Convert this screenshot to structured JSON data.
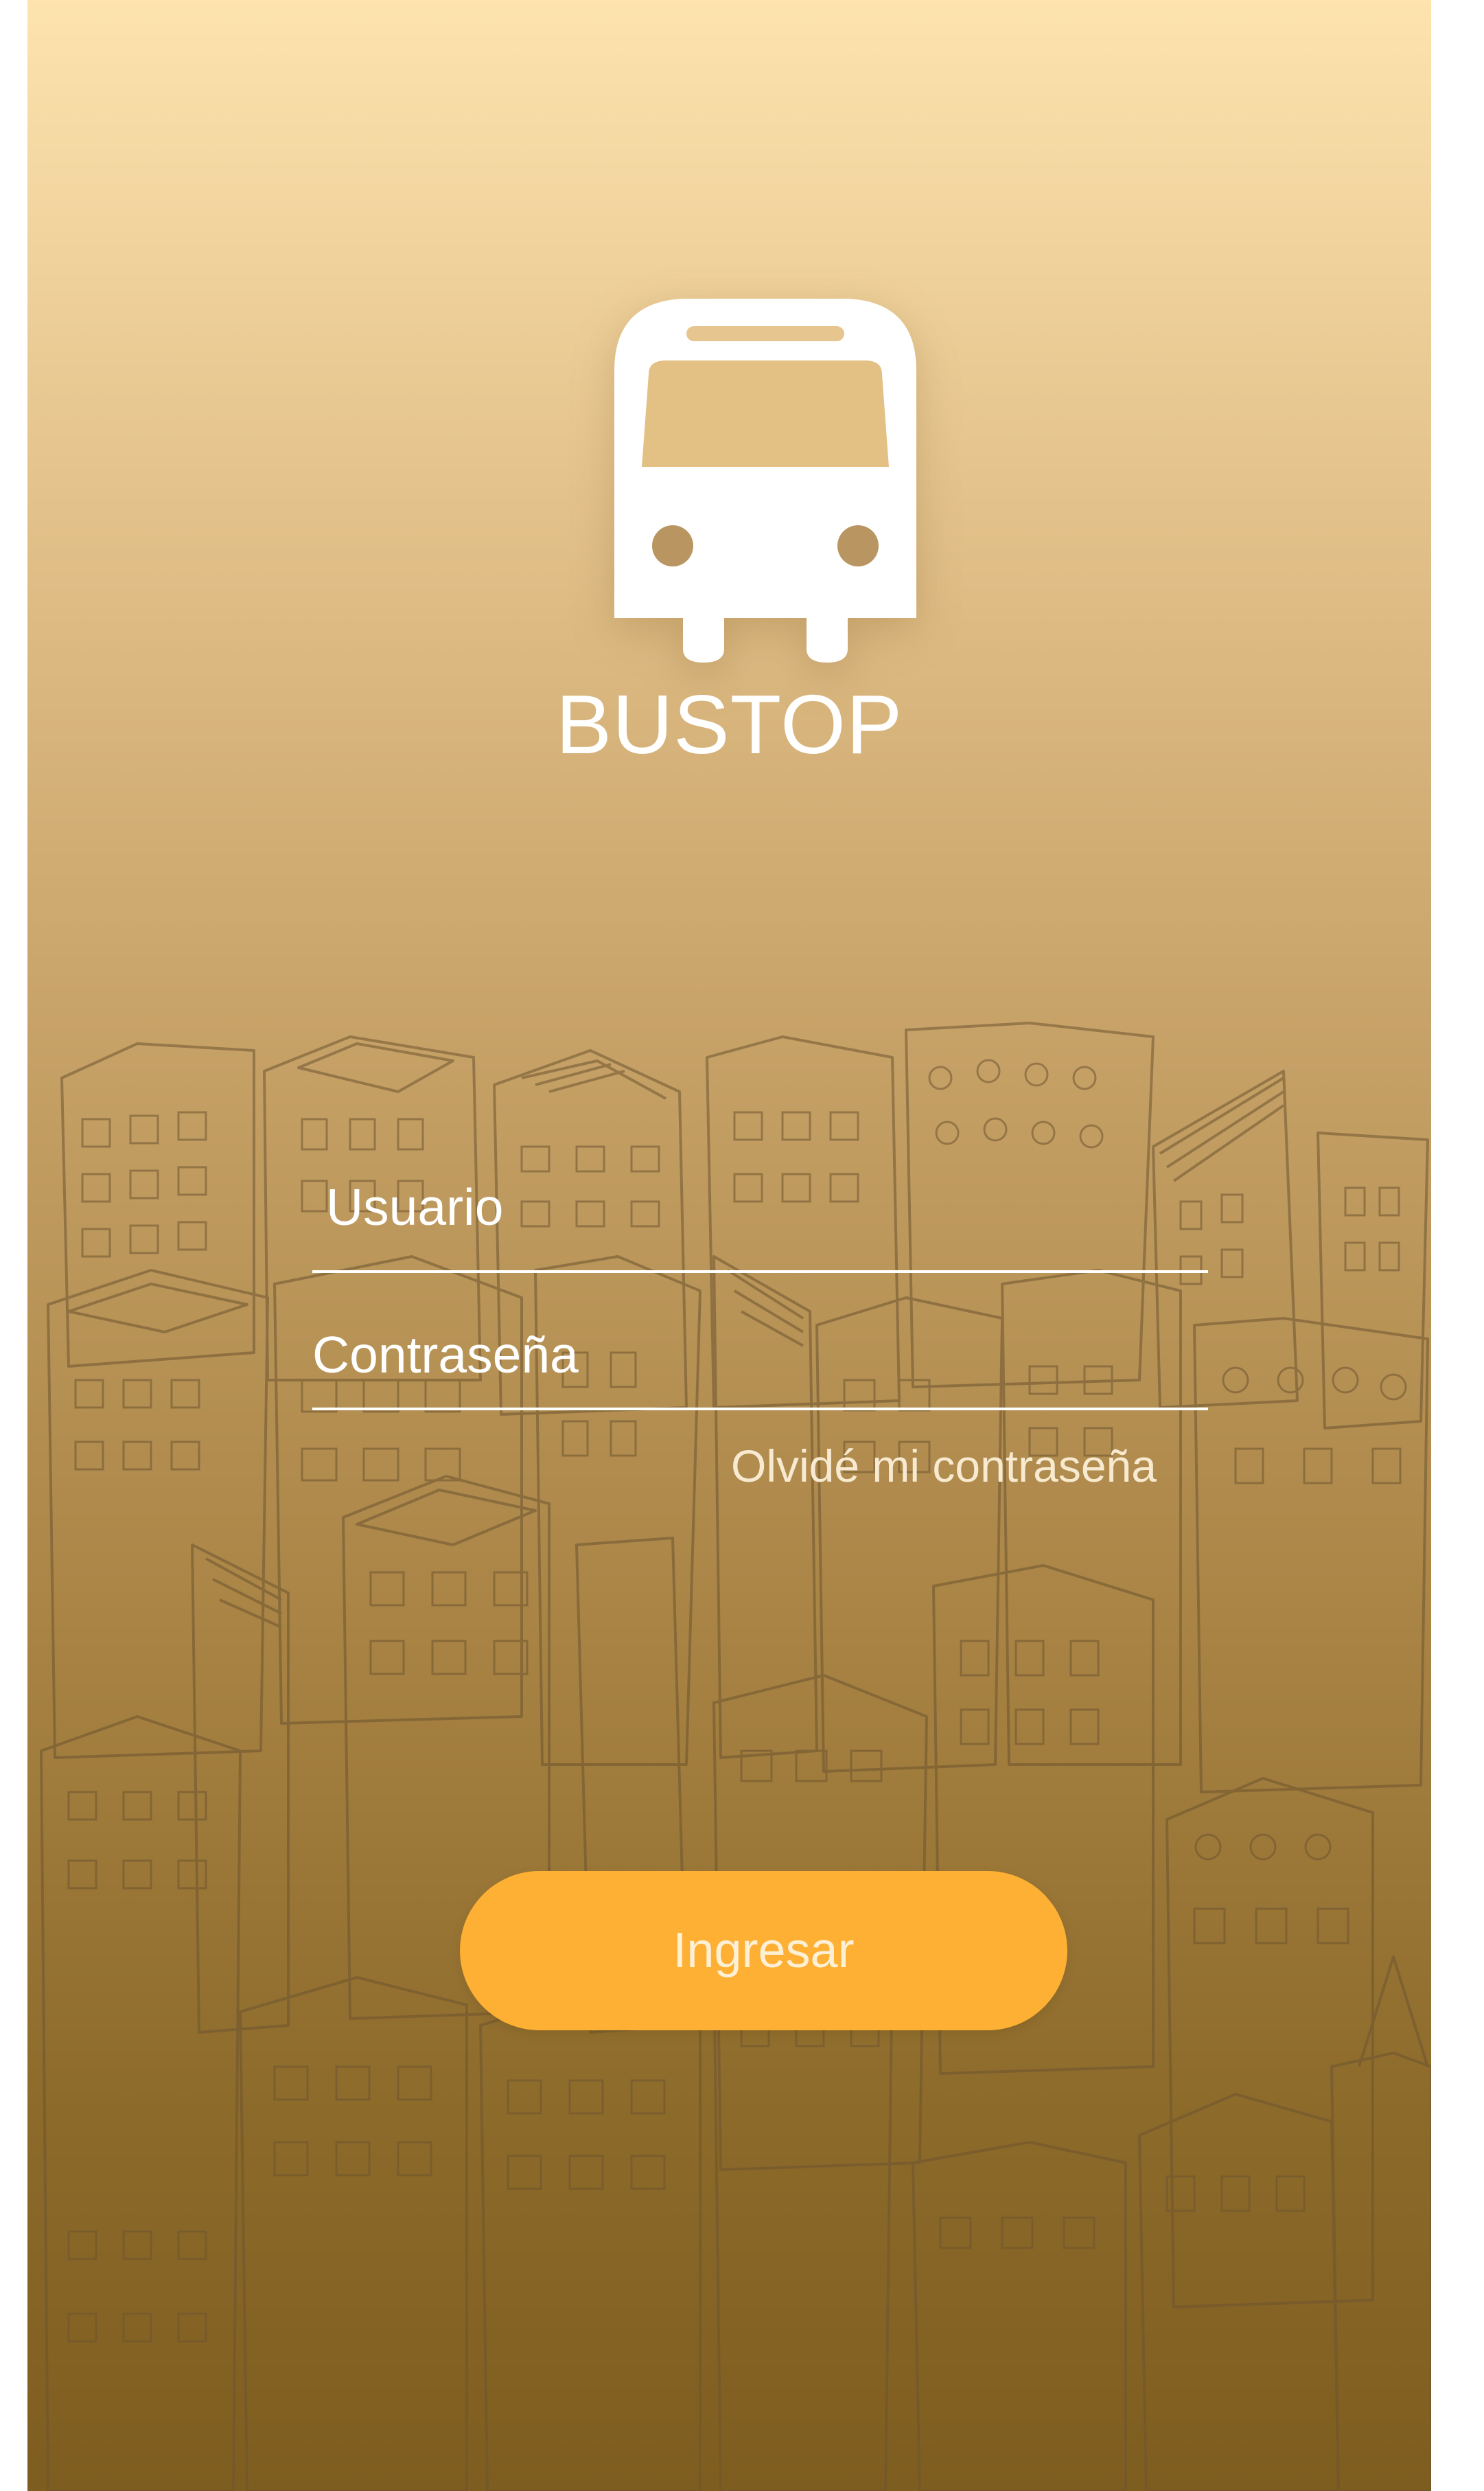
{
  "app": {
    "title": "BUSTOP"
  },
  "form": {
    "username_placeholder": "Usuario",
    "password_placeholder": "Contraseña",
    "forgot_password": "Olvidé mi contraseña",
    "submit_label": "Ingresar"
  },
  "icons": {
    "logo": "bus-icon",
    "background": "city-buildings-illustration"
  },
  "colors": {
    "gradient_top": "#FDE3AE",
    "gradient_bottom": "#7E5D20",
    "button": "#FDB033",
    "text": "#FFFFFF",
    "sketch_lines": "#6E5530"
  }
}
